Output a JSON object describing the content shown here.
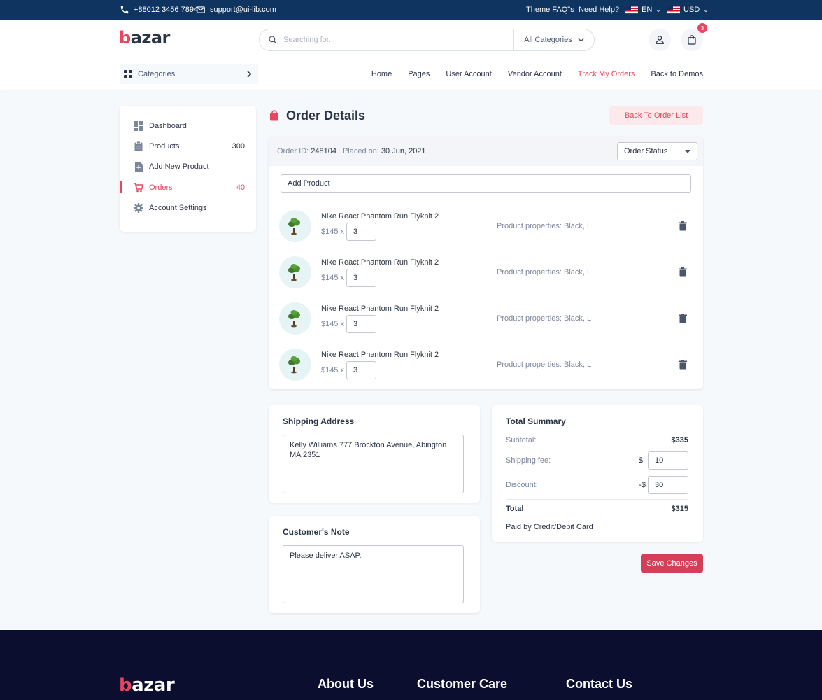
{
  "topbar": {
    "phone": "+88012 3456 7894",
    "email": "support@ui-lib.com",
    "faq": "Theme FAQ\"s",
    "help": "Need Help?",
    "language": "EN",
    "currency": "USD"
  },
  "header": {
    "logo_b": "b",
    "logo_rest": "azar",
    "search_placeholder": "Searching for...",
    "category_select": "All Categories",
    "cart_count": "3",
    "categories_label": "Categories"
  },
  "nav": {
    "items": [
      "Home",
      "Pages",
      "User Account",
      "Vendor Account",
      "Track My Orders",
      "Back to Demos"
    ],
    "active": "Track My Orders"
  },
  "sidebar": {
    "items": [
      {
        "label": "Dashboard",
        "count": "",
        "icon": "dashboard-icon"
      },
      {
        "label": "Products",
        "count": "300",
        "icon": "clipboard-icon"
      },
      {
        "label": "Add New Product",
        "count": "",
        "icon": "add-file-icon"
      },
      {
        "label": "Orders",
        "count": "40",
        "icon": "cart-icon"
      },
      {
        "label": "Account Settings",
        "count": "",
        "icon": "gear-icon"
      }
    ],
    "active": "Orders"
  },
  "page": {
    "title": "Order Details",
    "back_button": "Back To Order List"
  },
  "order": {
    "id_label": "Order ID:",
    "id": "248104",
    "placed_label": "Placed on:",
    "placed": "30 Jun, 2021",
    "status_placeholder": "Order Status",
    "add_product_placeholder": "Add Product",
    "items": [
      {
        "name": "Nike React Phantom Run Flyknit 2",
        "price": "$145 x",
        "qty": "3",
        "properties": "Product properties: Black, L"
      },
      {
        "name": "Nike React Phantom Run Flyknit 2",
        "price": "$145 x",
        "qty": "3",
        "properties": "Product properties: Black, L"
      },
      {
        "name": "Nike React Phantom Run Flyknit 2",
        "price": "$145 x",
        "qty": "3",
        "properties": "Product properties: Black, L"
      },
      {
        "name": "Nike React Phantom Run Flyknit 2",
        "price": "$145 x",
        "qty": "3",
        "properties": "Product properties: Black, L"
      }
    ]
  },
  "shipping": {
    "title": "Shipping Address",
    "address": "Kelly Williams 777 Brockton Avenue, Abington MA 2351"
  },
  "note": {
    "title": "Customer's Note",
    "text": "Please deliver ASAP."
  },
  "summary": {
    "title": "Total Summary",
    "subtotal_label": "Subtotal:",
    "subtotal": "$335",
    "shipping_label": "Shipping fee:",
    "shipping_symbol": "$",
    "shipping_value": "10",
    "discount_label": "Discount:",
    "discount_symbol": "-$",
    "discount_value": "30",
    "total_label": "Total",
    "total": "$315",
    "payment": "Paid by Credit/Debit Card",
    "save_button": "Save Changes"
  },
  "footer": {
    "logo_b": "b",
    "logo_rest": "azar",
    "columns": [
      "About Us",
      "Customer Care",
      "Contact Us"
    ]
  },
  "colors": {
    "primary": "#e94560",
    "navy": "#0f3460",
    "footer": "#0c0e30",
    "save": "#d23f57"
  }
}
